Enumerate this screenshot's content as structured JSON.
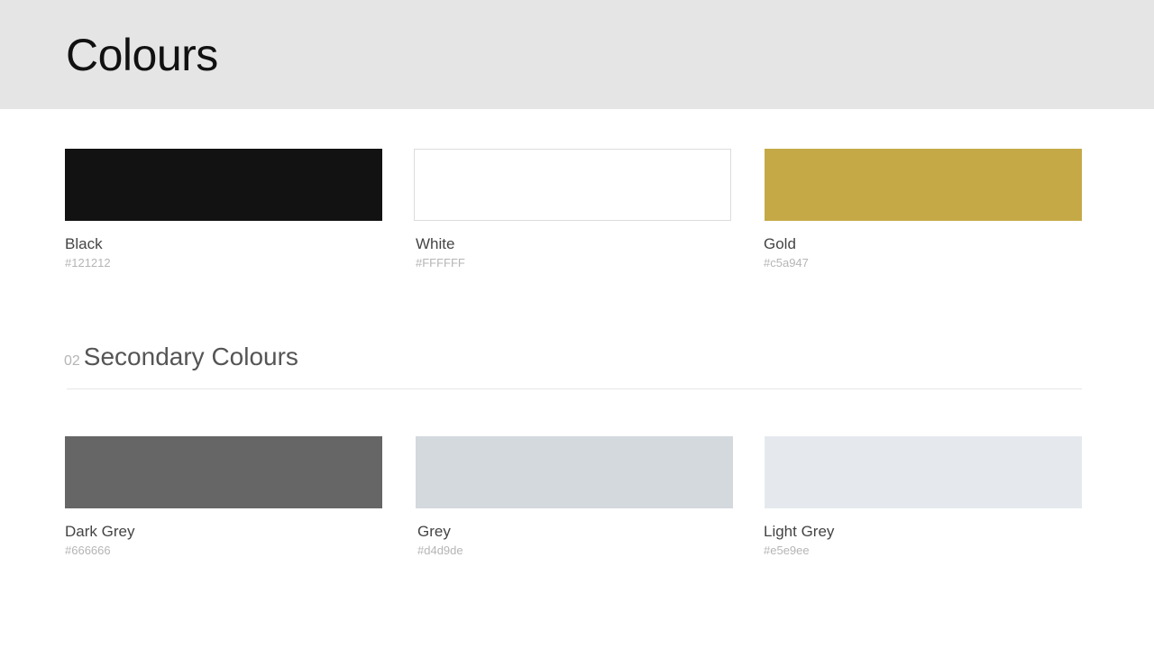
{
  "header": {
    "title": "Colours"
  },
  "primary_colours": [
    {
      "name": "Black",
      "hex_label": "#121212",
      "color": "#121212"
    },
    {
      "name": "White",
      "hex_label": "#FFFFFF",
      "color": "#FFFFFF"
    },
    {
      "name": "Gold",
      "hex_label": "#c5a947",
      "color": "#c5a947"
    }
  ],
  "secondary_section": {
    "number": "02",
    "title": "Secondary Colours"
  },
  "secondary_colours": [
    {
      "name": "Dark Grey",
      "hex_label": "#666666",
      "color": "#666666"
    },
    {
      "name": "Grey",
      "hex_label": "#d4d9de",
      "color": "#d4d9de"
    },
    {
      "name": "Light Grey",
      "hex_label": "#e5e9ee",
      "color": "#e5e9ee"
    }
  ]
}
